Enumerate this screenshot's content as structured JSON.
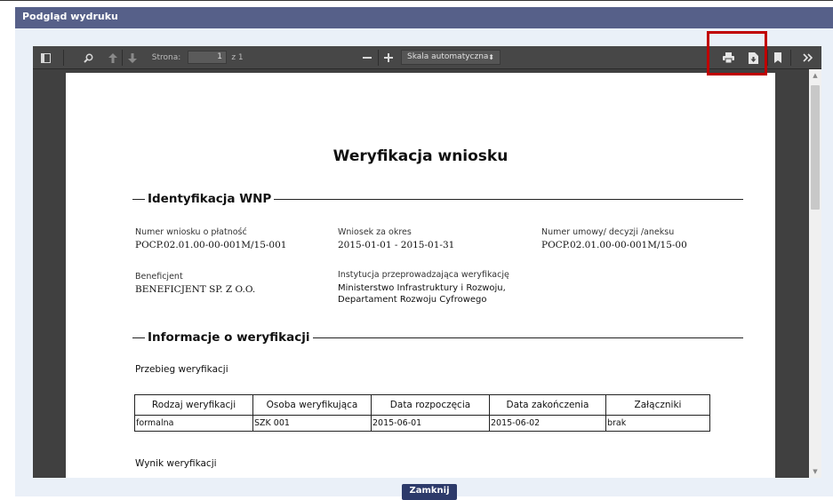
{
  "dialog": {
    "title": "Podgląd wydruku",
    "close_button": "Zamknij"
  },
  "toolbar": {
    "page_label": "Strona:",
    "page_number": "1",
    "page_total": "z 1",
    "zoom_value": "Skala automatyczna",
    "icons": [
      "sidebar-toggle-icon",
      "search-icon",
      "previous-page-icon",
      "next-page-icon",
      "zoom-out-icon",
      "zoom-in-icon",
      "print-icon",
      "download-icon",
      "bookmark-icon",
      "tools-icon"
    ]
  },
  "document": {
    "title": "Weryfikacja wniosku",
    "sections": {
      "identification": "Identyfikacja WNP",
      "verification_info": "Informacje o weryfikacji"
    },
    "fields": {
      "request_number_label": "Numer wniosku o płatność",
      "request_number_value": "POCP.02.01.00-00-001M/15-001",
      "period_label": "Wniosek za okres",
      "period_value": "2015-01-01 - 2015-01-31",
      "contract_label": "Numer umowy/ decyzji /aneksu",
      "contract_value": "POCP.02.01.00-00-001M/15-00",
      "beneficiary_label": "Beneficjent",
      "beneficiary_value": "BENEFICJENT SP. Z O.O.",
      "institution_label": "Instytucja przeprowadzająca weryfikację",
      "institution_value_1": "Ministerstwo Infrastruktury i Rozwoju,",
      "institution_value_2": "Departament Rozwoju Cyfrowego"
    },
    "verification_course_heading": "Przebieg weryfikacji",
    "table": {
      "headers": [
        "Rodzaj weryfikacji",
        "Osoba weryfikująca",
        "Data rozpoczęcia",
        "Data zakończenia",
        "Załączniki"
      ],
      "rows": [
        [
          "formalna",
          "SZK 001",
          "2015-06-01",
          "2015-06-02",
          "brak"
        ]
      ]
    },
    "verification_result_heading": "Wynik weryfikacji"
  },
  "colors": {
    "title_bar": "#566089",
    "viewer_bg": "#404040",
    "highlight": "#c00000"
  }
}
